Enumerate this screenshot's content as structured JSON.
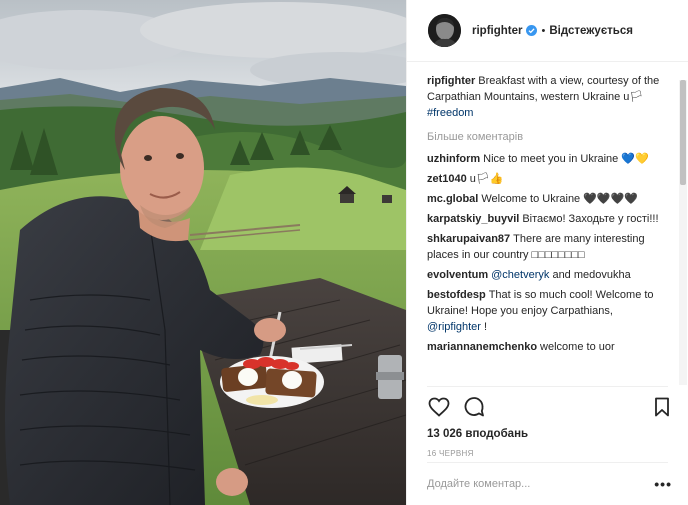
{
  "post": {
    "photo_alt": "Breakfast with a view, Carpathian Mountains",
    "author": {
      "username": "ripfighter",
      "verified": true,
      "follow_state": "Відстежується",
      "separator": "•"
    },
    "caption": {
      "username": "ripfighter",
      "text": "Breakfast with a view, courtesy of the Carpathian Mountains, western Ukraine",
      "flag": "u🏳",
      "hashtag": "#freedom"
    },
    "load_more_label": "Більше коментарів",
    "comments": [
      {
        "username": "uzhinform",
        "text": "Nice to meet you in Ukraine 💙💛"
      },
      {
        "username": "zet1040",
        "text": "u🏳👍"
      },
      {
        "username": "mc.global",
        "text": "Welcome to Ukraine 🖤🖤🖤🖤"
      },
      {
        "username": "karpatskiy_buyvil",
        "text": "Вітаємо! Заходьте у гості!!!"
      },
      {
        "username": "shkarupaivan87",
        "text": "There are many interesting places in our country □□□□□□□□"
      },
      {
        "username": "evolventum",
        "mention": "@chetveryk",
        "text": " and medovukha"
      },
      {
        "username": "bestofdesp",
        "text": "That is so much cool! Welcome to Ukraine! Hope you enjoy Carpathians, ",
        "mention": "@ripfighter",
        "text_after": " !"
      },
      {
        "username": "mariannanemchenko",
        "text": "welcome to uor"
      }
    ],
    "icons": {
      "like": "heart-icon",
      "comment": "comment-icon",
      "save": "bookmark-icon"
    },
    "likes_label": "13 026 вподобань",
    "date_label": "16 червня",
    "add_comment_placeholder": "Додайте коментар...",
    "options_label": "•••"
  },
  "colors": {
    "text": "#262626",
    "muted": "#999999",
    "link": "#003569",
    "verified": "#3897f0",
    "border": "#efefef"
  }
}
